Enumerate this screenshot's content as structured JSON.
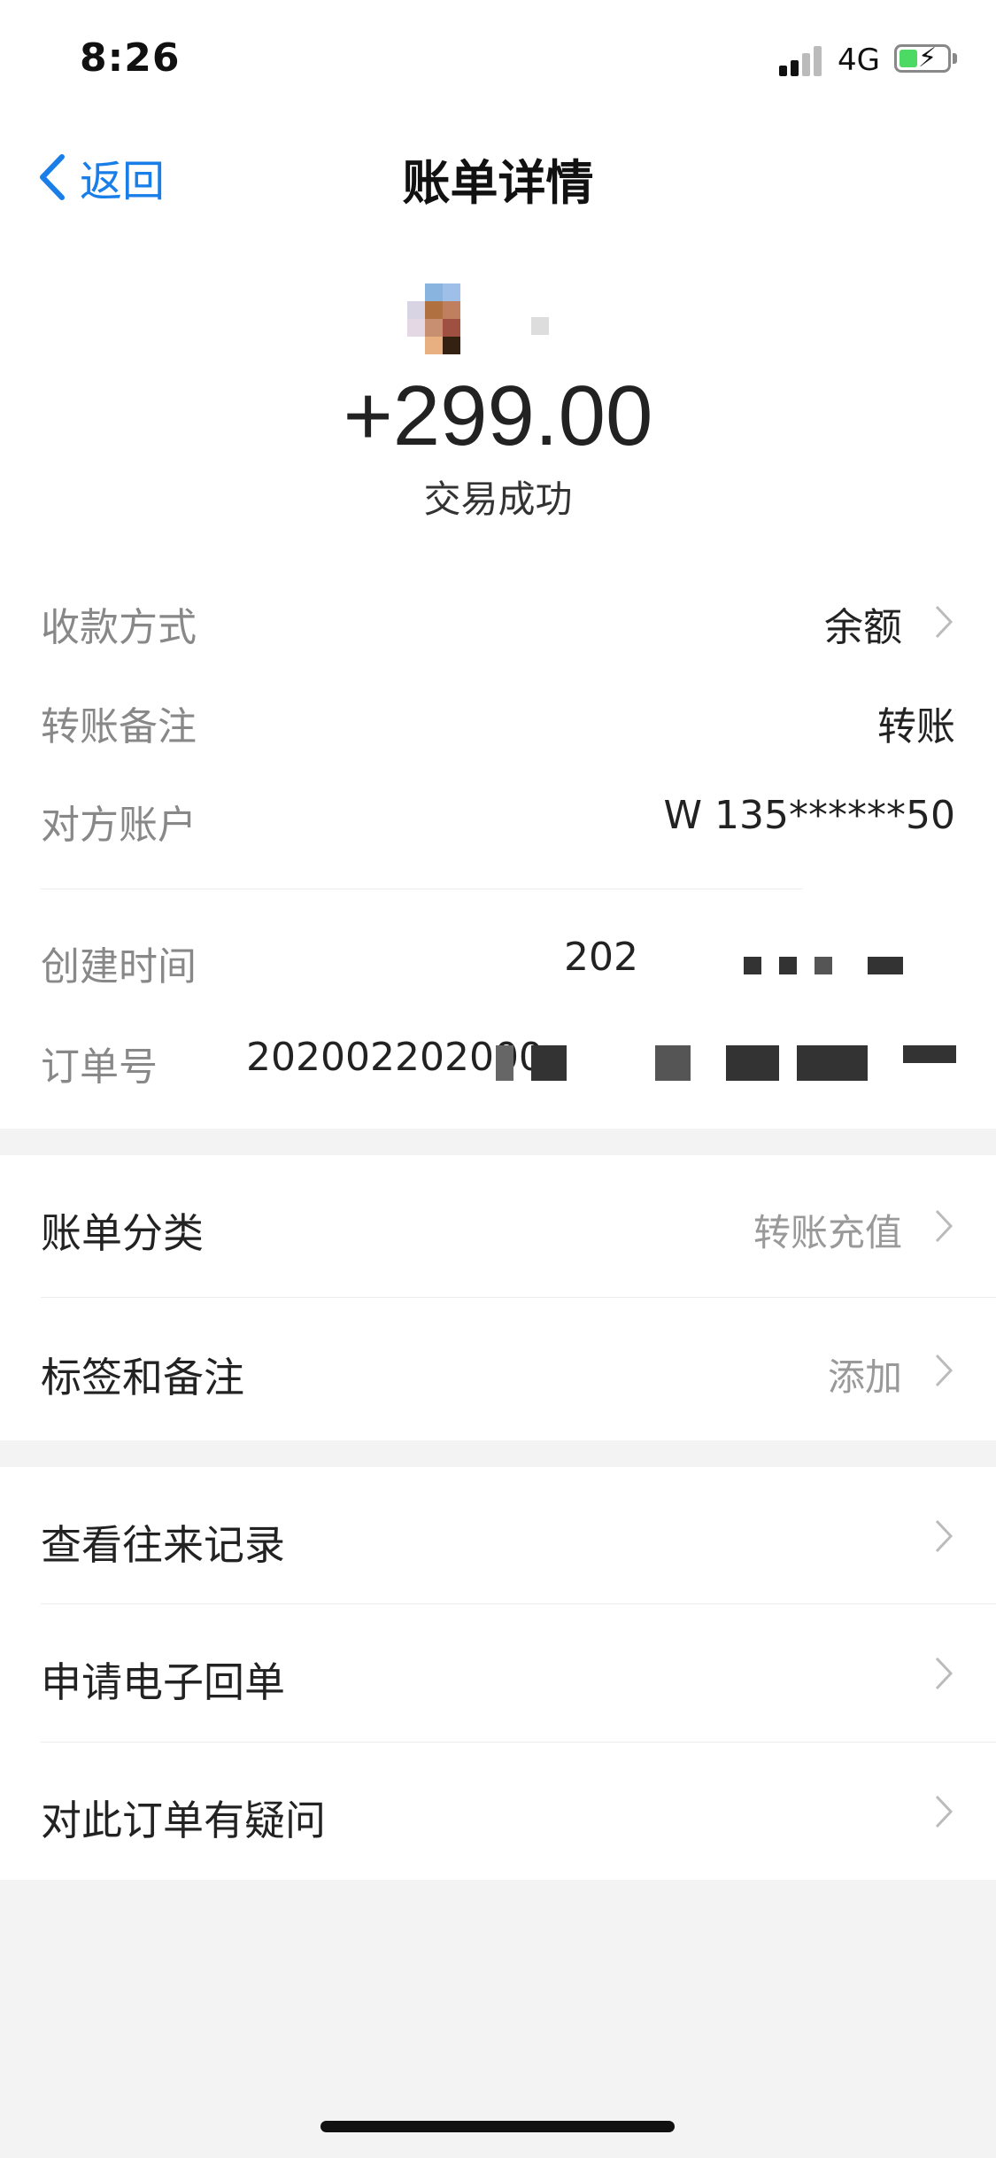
{
  "status_bar": {
    "time": "8:26",
    "network": "4G"
  },
  "nav": {
    "back_label": "返回",
    "title": "账单详情"
  },
  "header": {
    "amount": "+299.00",
    "status": "交易成功"
  },
  "details": [
    {
      "label": "收款方式",
      "value": "余额"
    },
    {
      "label": "转账备注",
      "value": "转账"
    },
    {
      "label": "对方账户",
      "value": "W 135******50"
    },
    {
      "label": "创建时间",
      "value": "202"
    },
    {
      "label": "订单号",
      "value": "202002202000"
    }
  ],
  "section1": [
    {
      "label": "账单分类",
      "value": "转账充值"
    },
    {
      "label": "标签和备注",
      "value": "添加"
    }
  ],
  "section2": [
    {
      "label": "查看往来记录"
    },
    {
      "label": "申请电子回单"
    },
    {
      "label": "对此订单有疑问"
    }
  ],
  "colors": {
    "accent": "#1a7ee8",
    "success": "#4cd964"
  }
}
